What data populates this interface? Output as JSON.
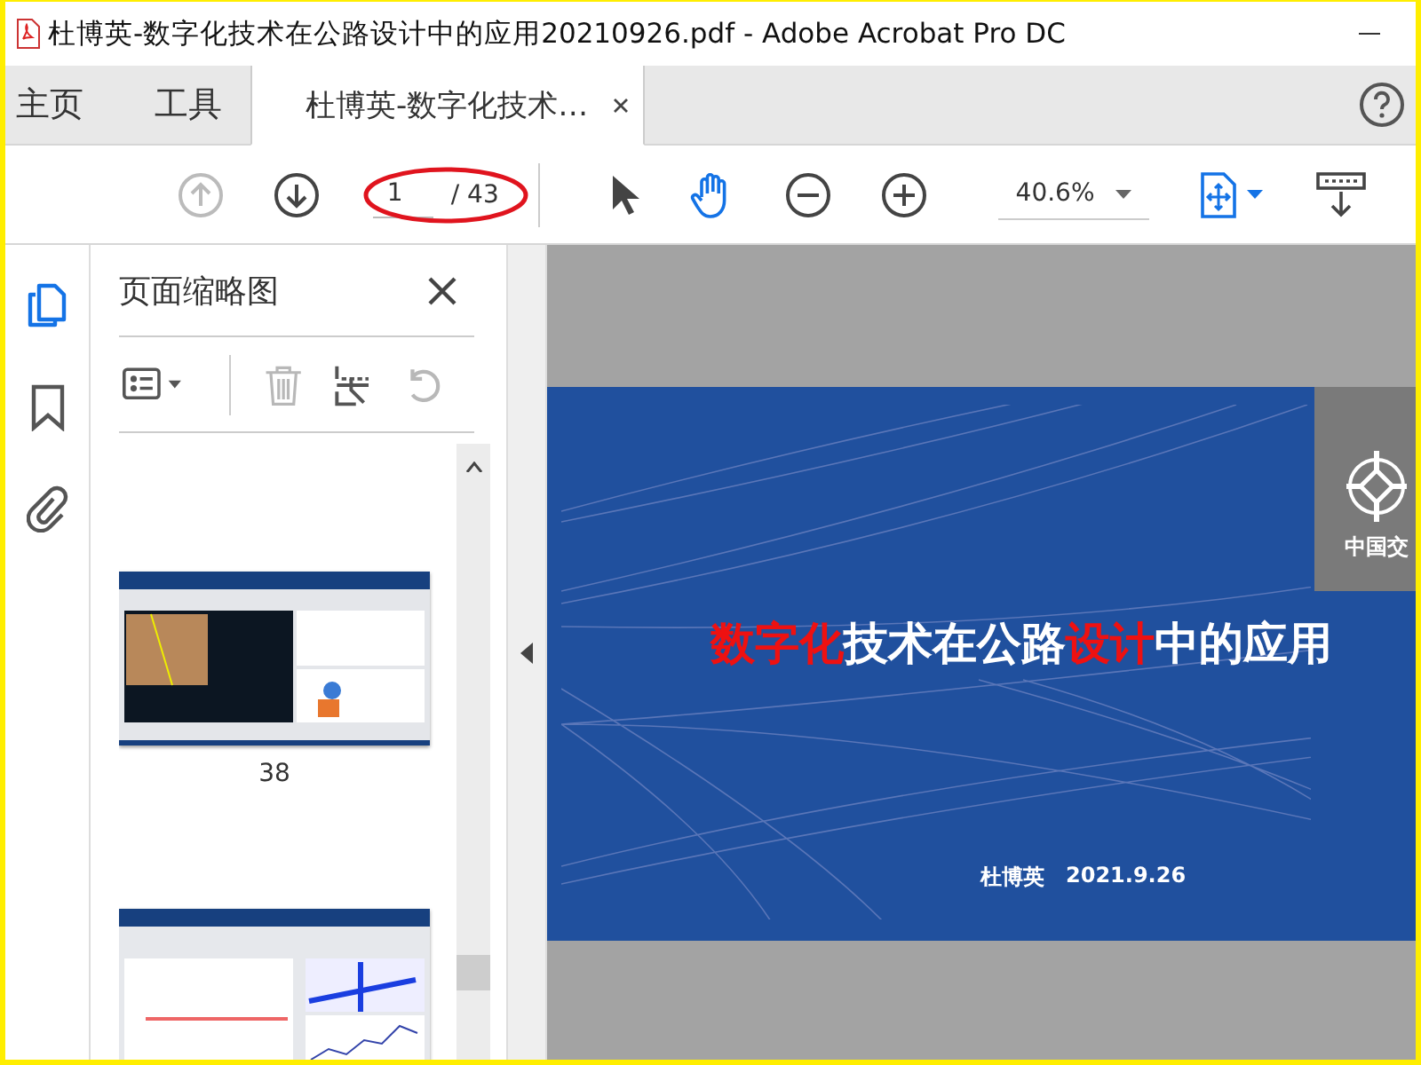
{
  "window": {
    "title": "杜博英-数字化技术在公路设计中的应用20210926.pdf - Adobe Acrobat Pro DC"
  },
  "tabs": [
    {
      "label": "主页",
      "kind": "nav",
      "selected": false
    },
    {
      "label": "工具",
      "kind": "nav",
      "selected": false
    },
    {
      "label": "杜博英-数字化技术…",
      "kind": "document",
      "selected": true
    }
  ],
  "toolbar": {
    "prev_page": {
      "disabled": true
    },
    "next_page": {
      "disabled": false
    },
    "page_field": {
      "value": "1"
    },
    "page_total": "/ 43",
    "tools": [
      {
        "kind": "select",
        "selected": false
      },
      {
        "kind": "hand",
        "selected": true
      }
    ],
    "zoom": {
      "value": "40.6%"
    }
  },
  "annotations": [
    {
      "kind": "ellipse"
    }
  ],
  "side_rail": [
    {
      "kind": "pages",
      "selected": true
    },
    {
      "kind": "bookmarks",
      "selected": false
    },
    {
      "kind": "attachments",
      "selected": false
    }
  ],
  "thumbnail_panel": {
    "title": "页面缩略图",
    "tools": [
      {
        "kind": "options",
        "disabled": false
      },
      {
        "kind": "delete",
        "disabled": true
      },
      {
        "kind": "extract",
        "disabled": false
      },
      {
        "kind": "rotate",
        "disabled": true
      }
    ],
    "thumbnails": [
      {
        "label": "38",
        "kind": "monitor"
      },
      {
        "kind": "bridge"
      }
    ]
  },
  "slide": {
    "title_parts": [
      {
        "text": "数字化",
        "highlight": true
      },
      {
        "text": "技术在公路",
        "highlight": false
      },
      {
        "text": "设计",
        "highlight": true
      },
      {
        "text": "中的应用",
        "highlight": false
      }
    ],
    "logo_text": "中国交",
    "author": "杜博英",
    "date": "2021.9.26"
  }
}
